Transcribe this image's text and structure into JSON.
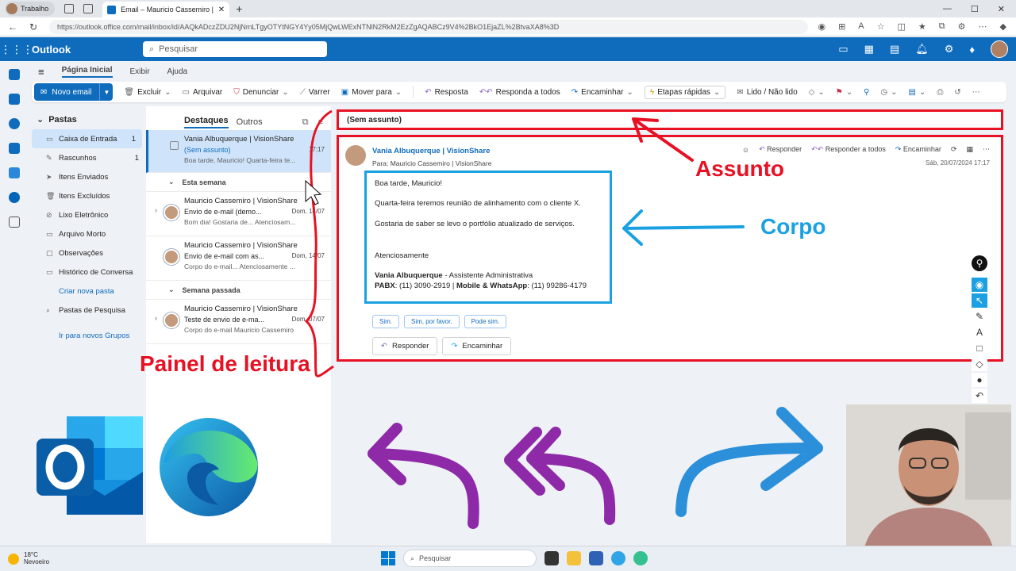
{
  "browser": {
    "profile": "Trabalho",
    "tab_title": "Email – Mauricio Cassemiro | VisionShare",
    "url": "https://outlook.office.com/mail/inbox/id/AAQkADczZDU2NjNmLTgyOTYtNGY4Yy05MjQwLWExNTNlN2RkM2EzZgAQABCz9V4%2BkO1EjaZL%2BtvaXA8%3D"
  },
  "outlook": {
    "brand": "Outlook",
    "search_placeholder": "Pesquisar",
    "ribbon_tabs": [
      "Página Inicial",
      "Exibir",
      "Ajuda"
    ]
  },
  "toolbar": {
    "new_mail": "Novo email",
    "delete": "Excluir",
    "archive": "Arquivar",
    "report": "Denunciar",
    "sweep": "Varrer",
    "move": "Mover para",
    "reply": "Resposta",
    "reply_all": "Responda a todos",
    "forward": "Encaminhar",
    "quick_steps": "Etapas rápidas",
    "read_unread": "Lido / Não lido"
  },
  "folders": {
    "header": "Pastas",
    "items": [
      {
        "label": "Caixa de Entrada",
        "count": "1",
        "icon": "inbox-icon"
      },
      {
        "label": "Rascunhos",
        "count": "1",
        "icon": "draft-icon"
      },
      {
        "label": "Itens Enviados",
        "count": "",
        "icon": "send-icon"
      },
      {
        "label": "Itens Excluídos",
        "count": "",
        "icon": "trash-icon"
      },
      {
        "label": "Lixo Eletrônico",
        "count": "",
        "icon": "junk-icon"
      },
      {
        "label": "Arquivo Morto",
        "count": "",
        "icon": "archive-icon"
      },
      {
        "label": "Observações",
        "count": "",
        "icon": "note-icon"
      },
      {
        "label": "Histórico de Conversa",
        "count": "",
        "icon": "folder-icon"
      }
    ],
    "create_folder": "Criar nova pasta",
    "search_folders": "Pastas de Pesquisa",
    "groups_link": "Ir para novos Grupos"
  },
  "message_list": {
    "tab_focused": "Destaques",
    "tab_other": "Outros",
    "selected": {
      "from": "Vania Albuquerque | VisionShare",
      "subject": "(Sem assunto)",
      "time": "17:17",
      "preview": "Boa tarde, Mauricio! Quarta-feira te..."
    },
    "group_this_week": "Esta semana",
    "group_last_week": "Semana passada",
    "messages_week": [
      {
        "from": "Mauricio Cassemiro | VisionShare",
        "subject": "Envio de e-mail (demo...",
        "date": "Dom, 14/07",
        "preview": "Bom dia! Gostaria de... Atenciosam..."
      },
      {
        "from": "Mauricio Cassemiro | VisionShare",
        "subject": "Envio de e-mail com as...",
        "date": "Dom, 14/07",
        "preview": "Corpo do e-mail... Atenciosamente ..."
      }
    ],
    "messages_last": [
      {
        "from": "Mauricio Cassemiro | VisionShare",
        "subject": "Teste de envio de e-ma...",
        "date": "Dom, 07/07",
        "preview": "Corpo do e-mail Mauricio Cassemiro"
      }
    ]
  },
  "reading": {
    "subject": "(Sem assunto)",
    "from": "Vania Albuquerque | VisionShare",
    "to_label": "Para:",
    "to": "Mauricio Cassemiro | VisionShare",
    "date": "Sáb, 20/07/2024 17:17",
    "actions": {
      "reply": "Responder",
      "reply_all": "Responder a todos",
      "forward": "Encaminhar"
    },
    "body": {
      "greeting": "Boa tarde, Mauricio!",
      "line1": "Quarta-feira teremos reunião de alinhamento com o cliente X.",
      "line2": "Gostaria de saber se levo o portfólio atualizado de serviços.",
      "closing": "Atenciosamente",
      "sig_name": "Vania Albuquerque",
      "sig_role": " - Assistente Administrativa",
      "sig_pabx_label": "PABX",
      "sig_pabx": ": (11) 3090-2919 | ",
      "sig_mobile_label": "Mobile & WhatsApp",
      "sig_mobile": ": (11) 99286-4179"
    },
    "quick_replies": [
      "Sim.",
      "Sim, por favor.",
      "Pode sim."
    ],
    "reply_button": "Responder",
    "forward_button": "Encaminhar"
  },
  "annotations": {
    "subject": "Assunto",
    "body": "Corpo",
    "reading_pane": "Painel de leitura"
  },
  "colors": {
    "accent": "#0f6cbd",
    "annotation_red": "#e81123",
    "annotation_blue": "#1ba1e2",
    "arrow_purple": "#8e2aa8"
  },
  "taskbar": {
    "temp": "18°C",
    "weather": "Nevoeiro",
    "search": "Pesquisar"
  }
}
